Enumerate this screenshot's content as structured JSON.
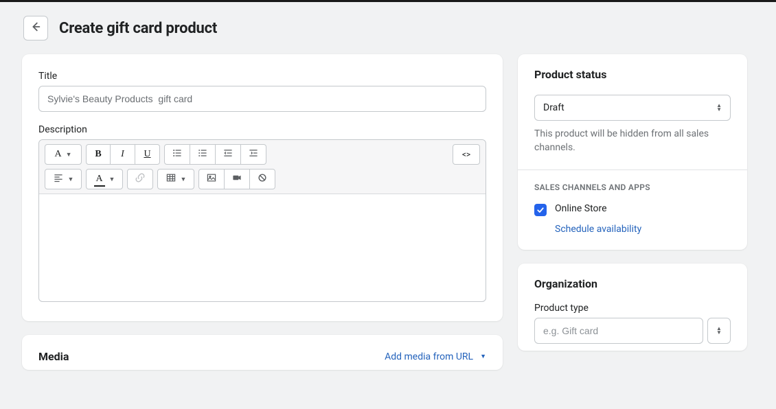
{
  "header": {
    "page_title": "Create gift card product"
  },
  "main": {
    "title_label": "Title",
    "title_value": "Sylvie's Beauty Products  gift card",
    "description_label": "Description",
    "media": {
      "section_title": "Media",
      "add_url_label": "Add media from URL"
    }
  },
  "sidebar": {
    "status": {
      "title": "Product status",
      "selected": "Draft",
      "helper": "This product will be hidden from all sales channels."
    },
    "channels": {
      "heading": "SALES CHANNELS AND APPS",
      "items": [
        {
          "label": "Online Store",
          "checked": true,
          "sub_link": "Schedule availability"
        }
      ]
    },
    "organization": {
      "title": "Organization",
      "product_type_label": "Product type",
      "product_type_placeholder": "e.g. Gift card"
    }
  }
}
